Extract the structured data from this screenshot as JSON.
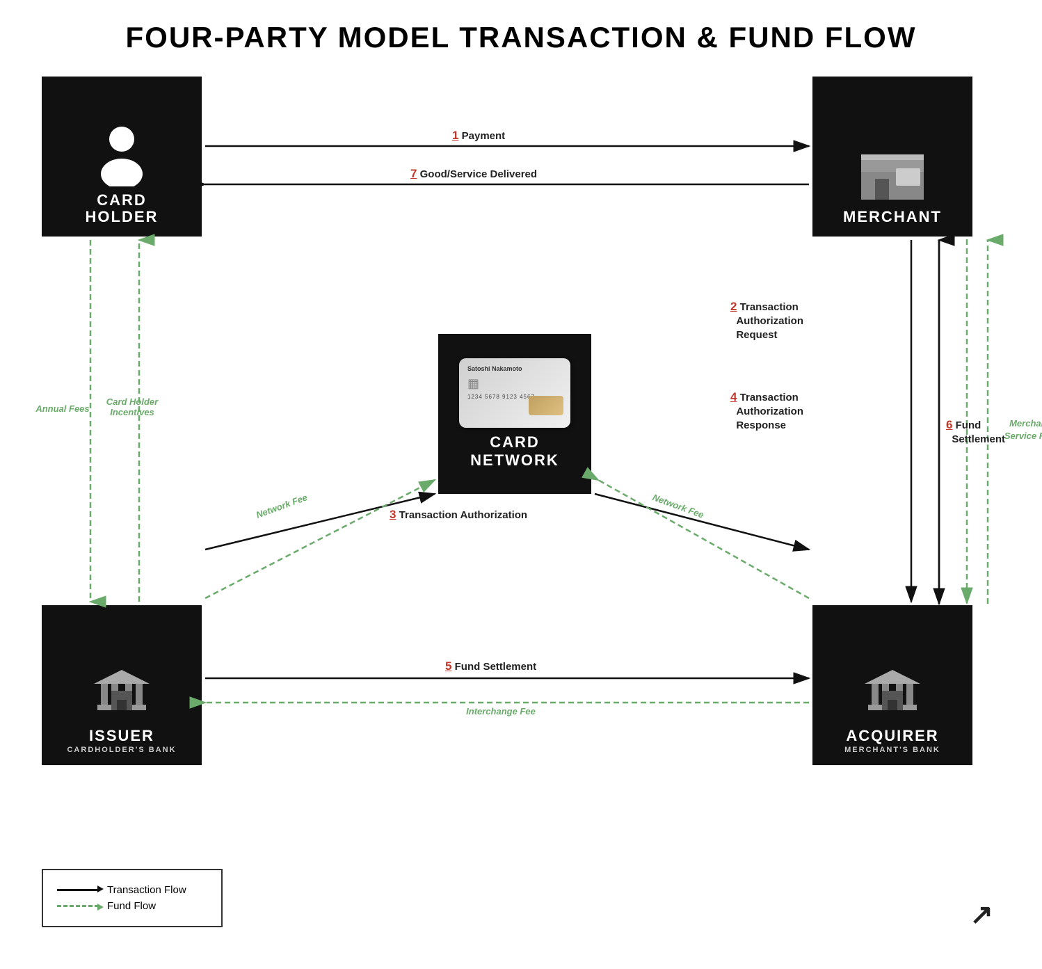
{
  "title": "FOUR-PARTY MODEL TRANSACTION & FUND FLOW",
  "parties": {
    "cardholder": {
      "label": "CARD\nHOLDER",
      "sublabel": ""
    },
    "merchant": {
      "label": "MERCHANT",
      "sublabel": ""
    },
    "issuer": {
      "label": "ISSUER",
      "sublabel": "CARDHOLDER'S BANK"
    },
    "acquirer": {
      "label": "ACQUIRER",
      "sublabel": "MERCHANT'S BANK"
    },
    "card_network": {
      "label": "CARD\nNETWORK",
      "sublabel": ""
    }
  },
  "card": {
    "name": "Satoshi Nakamoto",
    "number": "1234 5678 9123 4567"
  },
  "steps": {
    "s1": "Payment",
    "s2": "Transaction\nAuthorization\nRequest",
    "s3": "Transaction Authorization",
    "s4": "Transaction\nAuthorization\nResponse",
    "s5": "Fund Settlement",
    "s6": "Fund\nSettlement",
    "s7": "Good/Service Delivered"
  },
  "fees": {
    "annual_fees": "Annual Fees",
    "cardholder_incentives": "Card Holder\nIncentives",
    "network_fee_left": "Network Fee",
    "network_fee_right": "Network Fee",
    "interchange_fee": "Interchange Fee",
    "merchant_service_fee": "Merchant\nService Fee"
  },
  "legend": {
    "transaction_flow": "Transaction Flow",
    "fund_flow": "Fund Flow"
  }
}
